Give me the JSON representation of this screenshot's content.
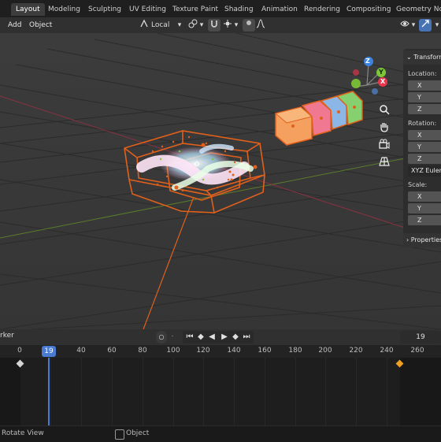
{
  "workspace_tabs": [
    "Layout",
    "Modeling",
    "Sculpting",
    "UV Editing",
    "Texture Paint",
    "Shading",
    "Animation",
    "Rendering",
    "Compositing",
    "Geometry Node"
  ],
  "header": {
    "menus": [
      "Add",
      "Object"
    ],
    "transform_orientation": "Local"
  },
  "gizmo": {
    "z": "Z",
    "y": "Y",
    "x": "X"
  },
  "npanel": {
    "transform_title": "Transform",
    "location_label": "Location:",
    "rotation_label": "Rotation:",
    "rotation_mode": "XYZ Euler",
    "scale_label": "Scale:",
    "axis": [
      "X",
      "Y",
      "Z"
    ],
    "properties_title": "Properties"
  },
  "timeline": {
    "marker_label": "rker",
    "current_frame": "19",
    "frame_field": "19",
    "ticks": [
      "0",
      "40",
      "60",
      "80",
      "100",
      "120",
      "140",
      "160",
      "180",
      "200",
      "220",
      "240",
      "260"
    ]
  },
  "status": {
    "left": "Rotate View",
    "right": "Object"
  },
  "colors": {
    "active_tab": "#3d3d3d",
    "selection_orange": "#e0601c",
    "playhead_blue": "#4a7bd0",
    "gizmo_x": "#e8364d",
    "gizmo_y": "#7dc736",
    "gizmo_z": "#3b83e0"
  }
}
